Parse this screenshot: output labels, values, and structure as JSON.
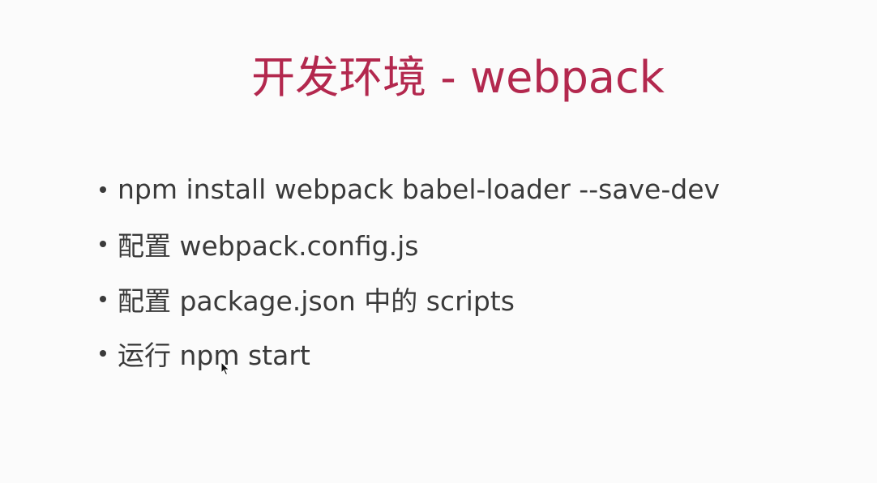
{
  "theme": {
    "accent": "#b3284e",
    "text": "#3a3a3a",
    "background": "#fbfbfb"
  },
  "slide": {
    "title": "开发环境 - webpack",
    "bullets": [
      {
        "text": "npm install webpack babel-loader --save-dev"
      },
      {
        "text": "配置 webpack.config.js"
      },
      {
        "text": "配置 package.json 中的 scripts"
      },
      {
        "text": "运行 npm start"
      }
    ]
  },
  "icons": {
    "cursor": "mouse-pointer-icon",
    "bullet": "bullet-dot-icon"
  }
}
